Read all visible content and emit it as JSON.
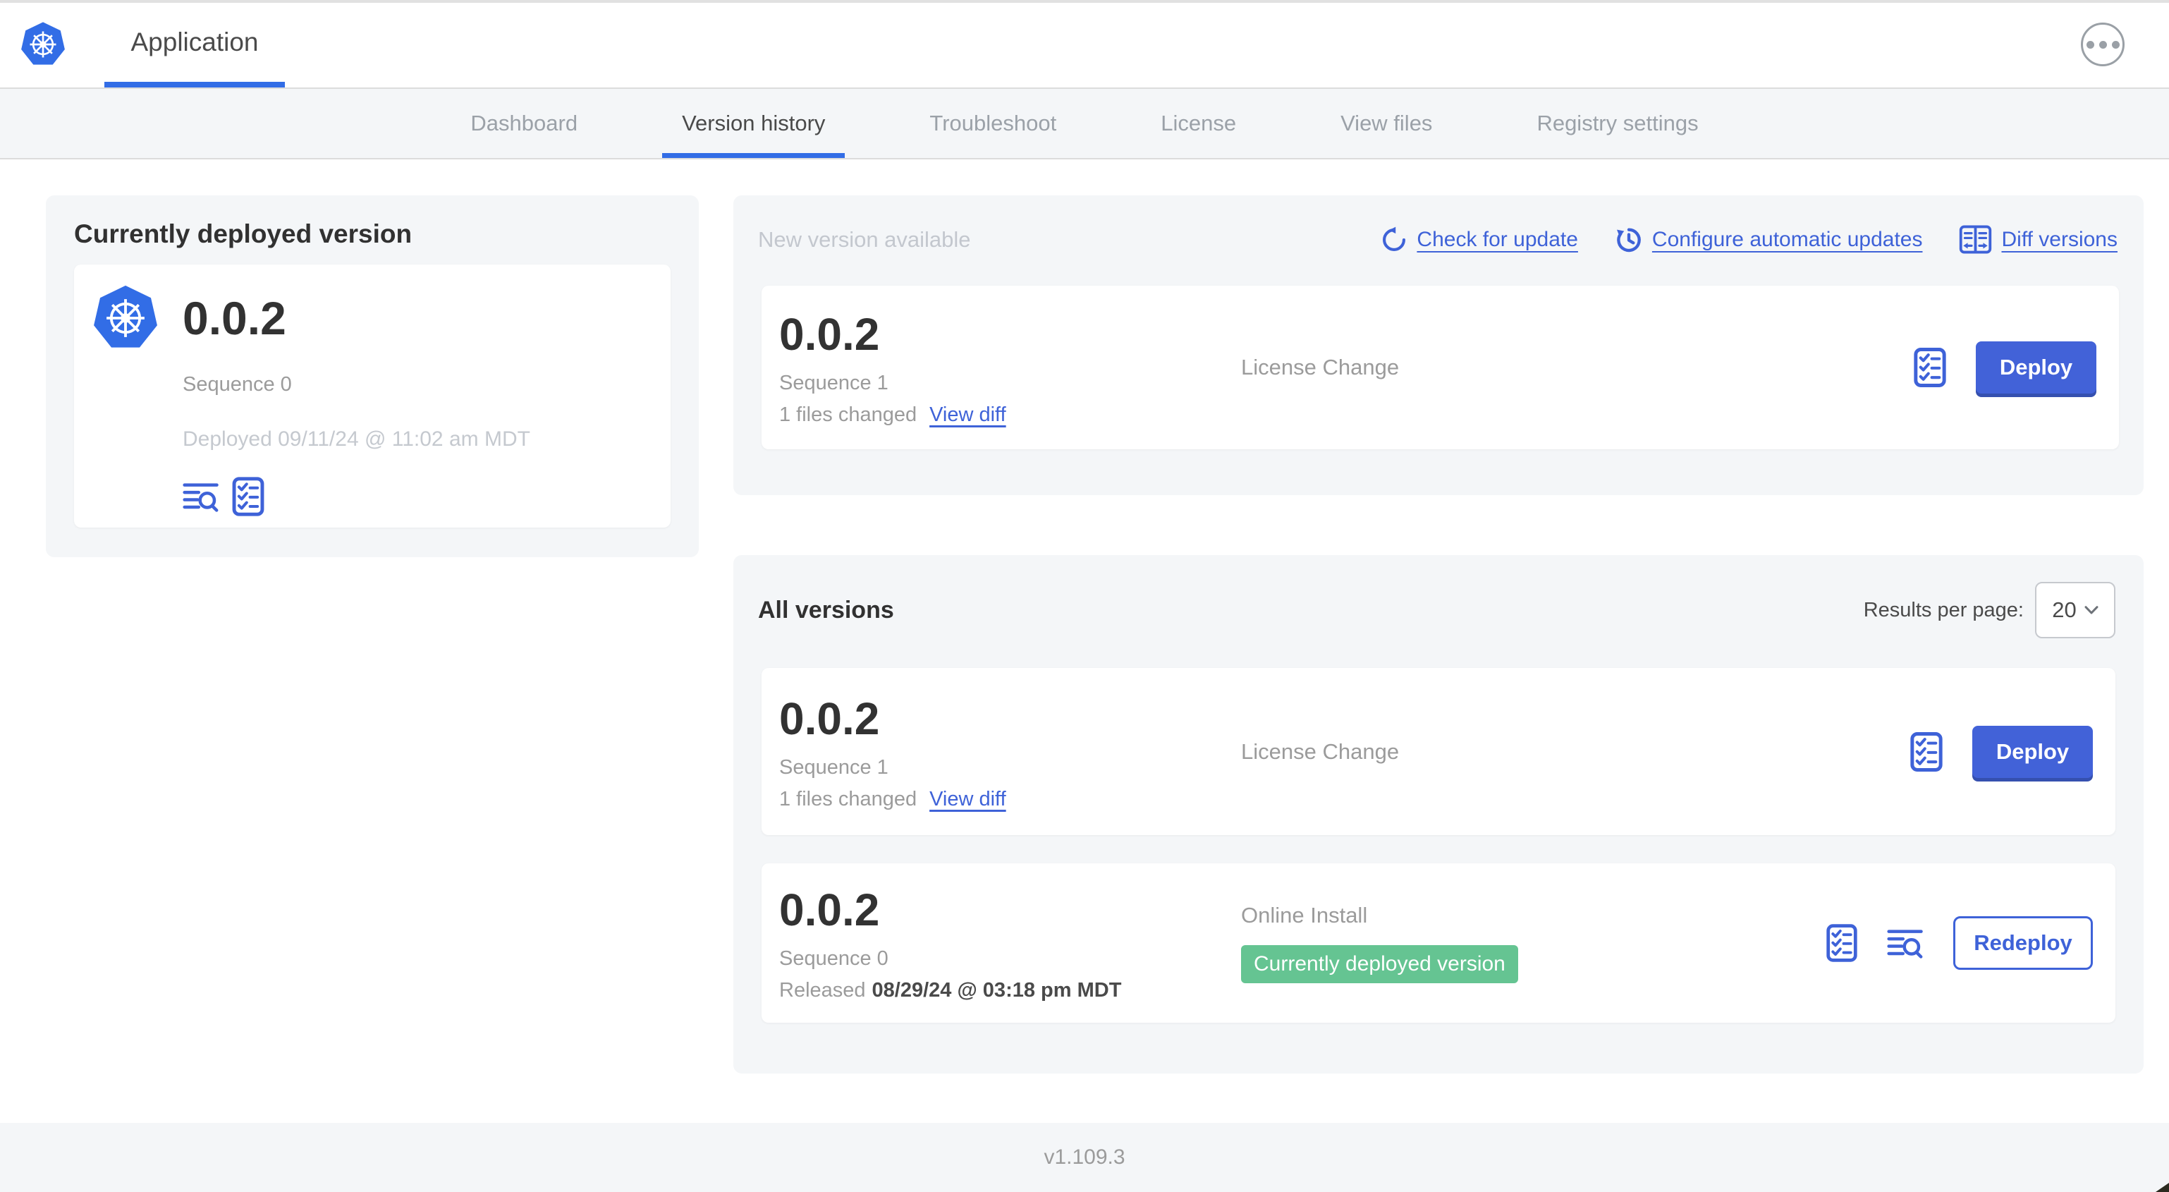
{
  "header": {
    "app_title": "Application"
  },
  "nav": {
    "tabs": [
      "Dashboard",
      "Version history",
      "Troubleshoot",
      "License",
      "View files",
      "Registry settings"
    ],
    "active_tab": "Version history"
  },
  "deployed": {
    "title": "Currently deployed version",
    "version": "0.0.2",
    "sequence": "Sequence 0",
    "deployed_at": "Deployed 09/11/24 @ 11:02 am MDT"
  },
  "actions": {
    "check_for_update": "Check for update",
    "configure_automatic_updates": "Configure automatic updates",
    "diff_versions": "Diff versions"
  },
  "new_version": {
    "title": "New version available",
    "version": "0.0.2",
    "sequence": "Sequence 1",
    "files_changed": "1 files changed",
    "view_diff": "View diff",
    "source": "License Change",
    "deploy_label": "Deploy"
  },
  "all_versions": {
    "title": "All versions",
    "results_per_page_label": "Results per page:",
    "results_per_page_value": "20",
    "rows": [
      {
        "version": "0.0.2",
        "sequence": "Sequence 1",
        "files_changed": "1 files changed",
        "view_diff": "View diff",
        "source": "License Change",
        "action_label": "Deploy"
      },
      {
        "version": "0.0.2",
        "sequence": "Sequence 0",
        "released_label": "Released",
        "released_date": "08/29/24 @ 03:18 pm MDT",
        "source": "Online Install",
        "badge": "Currently deployed version",
        "action_label": "Redeploy"
      }
    ]
  },
  "footer": {
    "app_version": "v1.109.3"
  },
  "icons": {
    "logo": "kubernetes-logo",
    "preflight": "checklist-icon",
    "logs": "logs-magnifier-icon",
    "check_update": "refresh-icon",
    "auto_update": "clock-refresh-icon",
    "diff": "diff-columns-icon",
    "more": "ellipsis-icon",
    "select": "chevron-down-icon"
  },
  "colors": {
    "accent_blue": "#3e62d8",
    "logo_blue": "#326de6",
    "deploy_button": "#4262d8",
    "badge_green": "#65c492",
    "panel_gray": "#f4f6f8",
    "text_dark": "#323232",
    "text_gray": "#9b9b9b",
    "text_light": "#c5c9cf"
  }
}
